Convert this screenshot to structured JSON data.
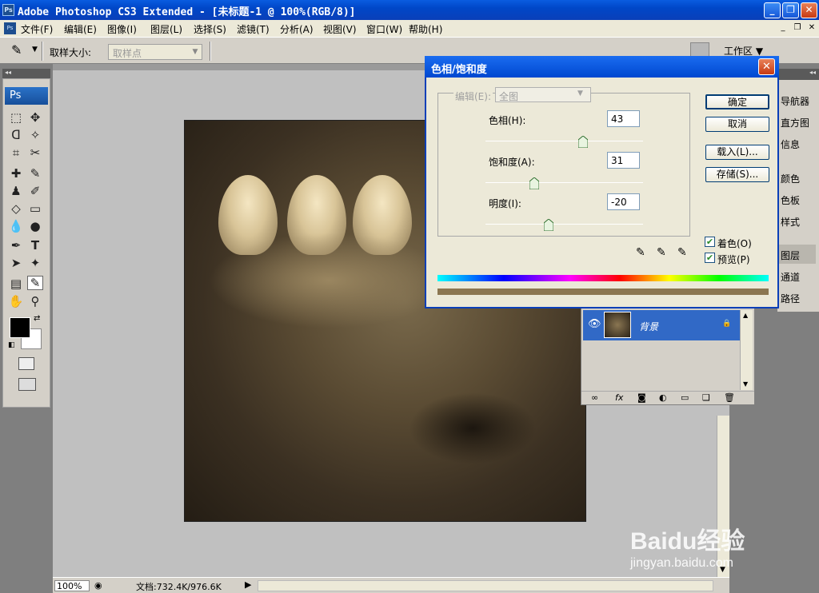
{
  "window": {
    "title": "Adobe Photoshop CS3 Extended - [未标题-1 @ 100%(RGB/8)]",
    "app_icon": "Ps",
    "controls": [
      "_",
      "❐",
      "✕"
    ]
  },
  "menu": {
    "items": [
      "文件(F)",
      "编辑(E)",
      "图像(I)",
      "图层(L)",
      "选择(S)",
      "滤镜(T)",
      "分析(A)",
      "视图(V)",
      "窗口(W)",
      "帮助(H)"
    ],
    "mdi_controls": [
      "_",
      "❐",
      "✕"
    ]
  },
  "options": {
    "sample_size_label": "取样大小:",
    "sample_size_value": "取样点",
    "workspace_label": "工作区 ▼"
  },
  "toolbox": {
    "logo": "Ps",
    "collapse": "◂◂"
  },
  "status": {
    "zoom": "100%",
    "doc_info": "文档:732.4K/976.6K"
  },
  "right_panel": {
    "collapse": "◂◂",
    "items": [
      "导航器",
      "直方图",
      "信息",
      "颜色",
      "色板",
      "样式",
      "图层",
      "通道",
      "路径"
    ]
  },
  "layers": {
    "layer_name": "背景"
  },
  "dialog": {
    "title": "色相/饱和度",
    "edit_label": "编辑(E):",
    "edit_value": "全图",
    "hue_label": "色相(H):",
    "hue_value": "43",
    "saturation_label": "饱和度(A):",
    "saturation_value": "31",
    "lightness_label": "明度(I):",
    "lightness_value": "-20",
    "ok": "确定",
    "cancel": "取消",
    "load": "载入(L)...",
    "save": "存储(S)...",
    "colorize_label": "着色(O)",
    "colorize_checked": true,
    "preview_label": "预览(P)",
    "preview_checked": true,
    "sliders": {
      "hue": 43,
      "hue_range": [
        -180,
        180
      ],
      "saturation": 31,
      "saturation_range": [
        0,
        100
      ],
      "lightness": -20,
      "lightness_range": [
        -100,
        100
      ]
    },
    "colorize_bar_color": "#8b7651"
  },
  "watermark": {
    "brand": "Baidu经验",
    "url": "jingyan.baidu.com"
  }
}
